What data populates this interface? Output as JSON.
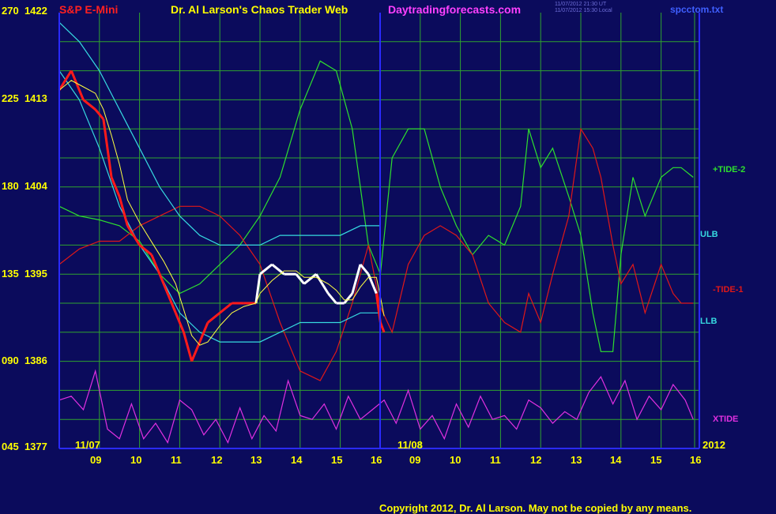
{
  "header": {
    "symbol": "S&P E-Mini",
    "title": "Dr. Al Larson's Chaos Trader Web",
    "website": "Daytradingforecasts.com",
    "timestamp_ut": "11/07/2012 21:30 UT",
    "timestamp_local": "11/07/2012 15:30 Local",
    "filename": "spcctom.txt"
  },
  "colors": {
    "background": "#0b0b5c",
    "grid": "#2fa32f",
    "axis": "#2a2aff",
    "labels": "#ffff00",
    "price_down": "#ff1a1a",
    "price_up": "#ffffff",
    "cyan": "#36d9e0",
    "tide2": "#2ee02e",
    "tide1": "#e01818",
    "xtide": "#e030e0"
  },
  "y_axis_labels": [
    {
      "tide": "270",
      "price": "1422"
    },
    {
      "tide": "225",
      "price": "1413"
    },
    {
      "tide": "180",
      "price": "1404"
    },
    {
      "tide": "135",
      "price": "1395"
    },
    {
      "tide": "090",
      "price": "1386"
    },
    {
      "tide": "045",
      "price": "1377"
    }
  ],
  "x_axis_labels": [
    "09",
    "10",
    "11",
    "12",
    "13",
    "14",
    "15",
    "16",
    "09",
    "10",
    "11",
    "12",
    "13",
    "14",
    "15",
    "16"
  ],
  "date_labels": [
    "11/07",
    "11/08",
    "2012"
  ],
  "series_labels": {
    "tide2": "+TIDE-2",
    "ulb": "ULB",
    "tide1": "-TIDE-1",
    "llb": "LLB",
    "xtide": "XTIDE"
  },
  "copyright": "Copyright 2012, Dr. Al Larson. May not be copied by any means.",
  "chart_data": {
    "type": "line",
    "grid": true,
    "x_range": [
      8.0,
      16.1
    ],
    "price_range": [
      1377,
      1422
    ],
    "tide_range": [
      45,
      270
    ],
    "day_divider": "between 11/07 16 and 11/08 09",
    "series": [
      {
        "name": "S&P E-Mini",
        "axis": "price",
        "x": [
          8.0,
          8.3,
          8.6,
          8.9,
          9.1,
          9.3,
          9.5,
          9.7,
          10.0,
          10.3,
          10.6,
          10.9,
          11.1,
          11.3,
          11.5,
          11.7,
          12.0,
          12.3,
          12.6,
          12.9,
          13.0,
          13.3,
          13.6,
          13.9,
          14.1,
          14.4,
          14.7,
          14.9,
          15.1,
          15.3,
          15.5,
          15.7,
          15.9,
          16.0,
          16.1
        ],
        "values": [
          1414,
          1416,
          1413,
          1412,
          1411,
          1405,
          1403,
          1400,
          1398,
          1397,
          1394,
          1391,
          1389,
          1386,
          1388,
          1390,
          1391,
          1392,
          1392,
          1392,
          1395,
          1396,
          1395,
          1395,
          1394,
          1395,
          1393,
          1392,
          1392,
          1393,
          1396,
          1395,
          1393,
          1390,
          1389
        ]
      },
      {
        "name": "ULB",
        "axis": "price",
        "x": [
          8.0,
          8.5,
          9.0,
          9.5,
          10.0,
          10.5,
          11.0,
          11.5,
          12.0,
          12.5,
          13.0,
          13.5,
          14.0,
          14.5,
          15.0,
          15.5,
          16.0
        ],
        "values": [
          1421,
          1419,
          1416,
          1412,
          1408,
          1404,
          1401,
          1399,
          1398,
          1398,
          1398,
          1399,
          1399,
          1399,
          1399,
          1400,
          1400
        ]
      },
      {
        "name": "LLB",
        "axis": "price",
        "x": [
          8.0,
          8.5,
          9.0,
          9.5,
          10.0,
          10.5,
          11.0,
          11.5,
          12.0,
          12.5,
          13.0,
          13.5,
          14.0,
          14.5,
          15.0,
          15.5,
          16.0
        ],
        "values": [
          1416,
          1413,
          1408,
          1402,
          1398,
          1395,
          1391,
          1389,
          1388,
          1388,
          1388,
          1389,
          1390,
          1390,
          1390,
          1391,
          1391
        ]
      },
      {
        "name": "+TIDE-2",
        "axis": "tide",
        "x": [
          8.0,
          8.5,
          9.0,
          9.5,
          10.0,
          10.5,
          11.0,
          11.5,
          12.0,
          12.5,
          13.0,
          13.5,
          14.0,
          14.5,
          14.9,
          15.3,
          15.7,
          16.0,
          16.3,
          16.7,
          17.1,
          17.5,
          17.9,
          18.3,
          18.7,
          19.1,
          19.5,
          19.7,
          20.0,
          20.3,
          20.7,
          21.0,
          21.3,
          21.5,
          21.8,
          22.0,
          22.3,
          22.6,
          23.0,
          23.3,
          23.5,
          23.8
        ],
        "values": [
          170,
          165,
          163,
          160,
          152,
          135,
          125,
          130,
          140,
          150,
          165,
          185,
          220,
          245,
          240,
          210,
          150,
          135,
          195,
          210,
          210,
          180,
          160,
          145,
          155,
          150,
          170,
          210,
          190,
          200,
          175,
          155,
          115,
          95,
          95,
          145,
          185,
          165,
          185,
          190,
          190,
          185
        ]
      },
      {
        "name": "-TIDE-1",
        "axis": "tide",
        "x": [
          8.0,
          8.5,
          9.0,
          9.5,
          10.0,
          10.5,
          11.0,
          11.5,
          12.0,
          12.5,
          13.0,
          13.5,
          14.0,
          14.5,
          14.9,
          15.3,
          15.7,
          16.0,
          16.3,
          16.7,
          17.1,
          17.5,
          17.9,
          18.3,
          18.7,
          19.1,
          19.5,
          19.7,
          20.0,
          20.3,
          20.7,
          21.0,
          21.3,
          21.5,
          21.8,
          22.0,
          22.3,
          22.6,
          23.0,
          23.3,
          23.5,
          23.8
        ],
        "values": [
          140,
          148,
          152,
          152,
          160,
          165,
          170,
          170,
          165,
          155,
          140,
          110,
          85,
          80,
          95,
          120,
          150,
          118,
          105,
          140,
          155,
          160,
          155,
          145,
          120,
          110,
          105,
          125,
          110,
          135,
          165,
          210,
          200,
          185,
          150,
          130,
          140,
          115,
          140,
          125,
          120,
          120
        ]
      },
      {
        "name": "XTIDE",
        "axis": "tide",
        "x": [
          8.0,
          8.3,
          8.6,
          8.9,
          9.2,
          9.5,
          9.8,
          10.1,
          10.4,
          10.7,
          11.0,
          11.3,
          11.6,
          11.9,
          12.2,
          12.5,
          12.8,
          13.1,
          13.4,
          13.7,
          14.0,
          14.3,
          14.6,
          14.9,
          15.2,
          15.5,
          15.8,
          16.1,
          16.4,
          16.7,
          17.0,
          17.3,
          17.6,
          17.9,
          18.2,
          18.5,
          18.8,
          19.1,
          19.4,
          19.7,
          20.0,
          20.3,
          20.6,
          20.9,
          21.2,
          21.5,
          21.8,
          22.1,
          22.4,
          22.7,
          23.0,
          23.3,
          23.6,
          23.8
        ],
        "values": [
          70,
          72,
          65,
          85,
          55,
          50,
          68,
          50,
          58,
          48,
          70,
          65,
          52,
          60,
          48,
          66,
          50,
          62,
          54,
          80,
          62,
          60,
          68,
          55,
          72,
          60,
          65,
          70,
          58,
          75,
          55,
          62,
          50,
          68,
          56,
          72,
          60,
          62,
          55,
          70,
          66,
          58,
          64,
          60,
          74,
          82,
          68,
          80,
          60,
          72,
          65,
          78,
          70,
          60
        ]
      }
    ]
  }
}
